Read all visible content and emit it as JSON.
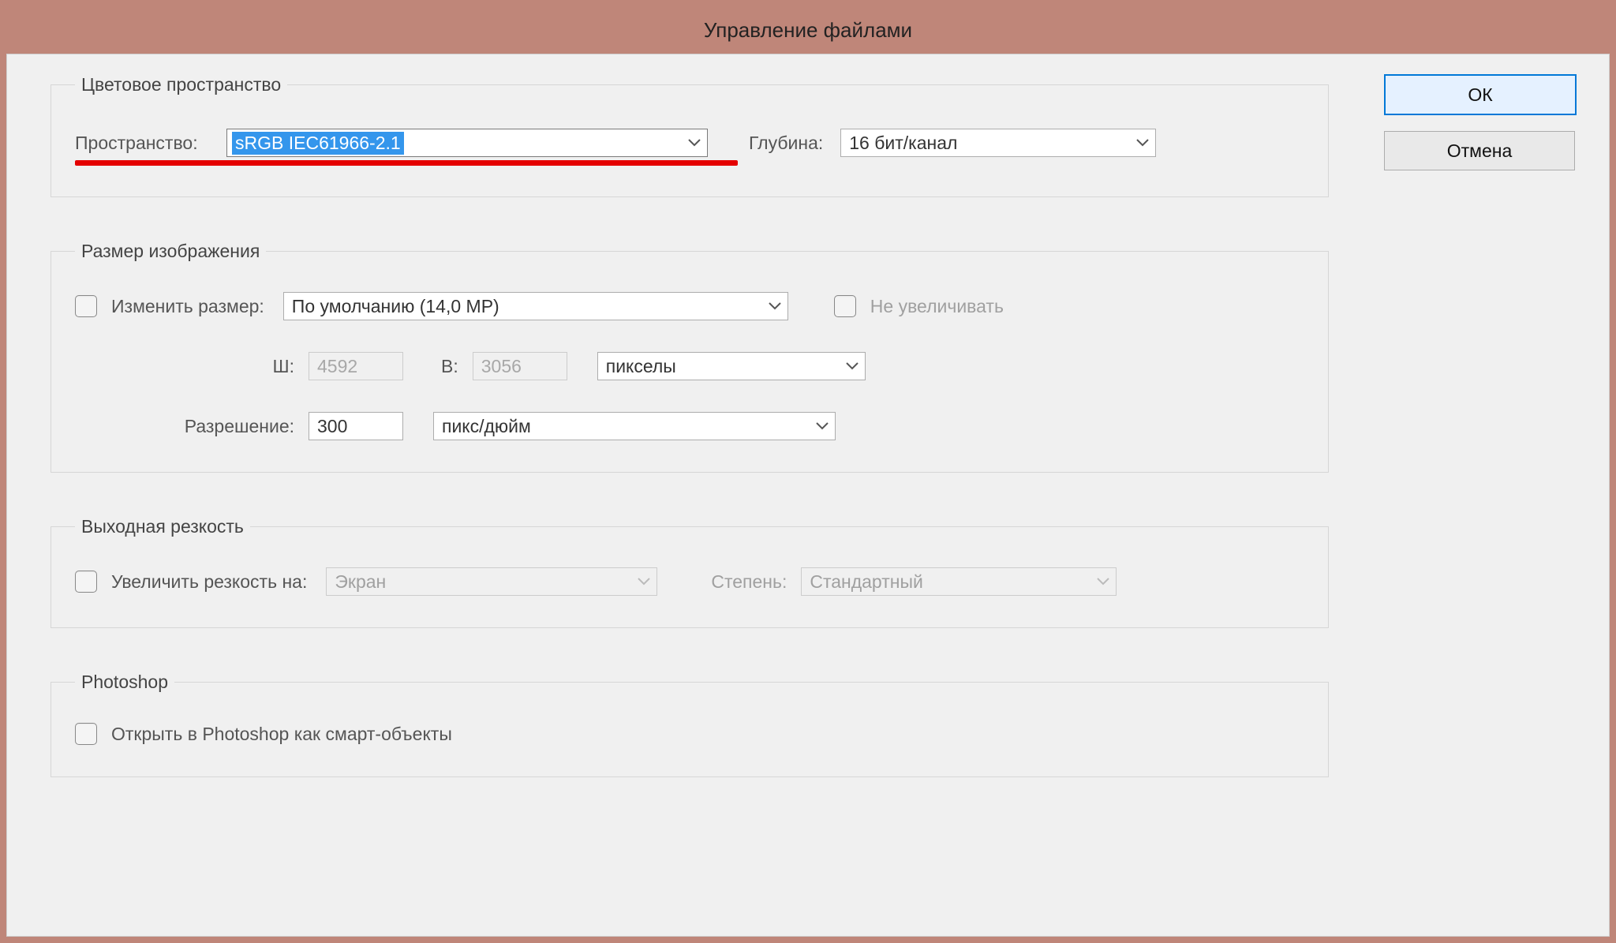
{
  "window_title": "Управление файлами",
  "buttons": {
    "ok": "ОК",
    "cancel": "Отмена"
  },
  "color_space": {
    "legend": "Цветовое пространство",
    "space_label": "Пространство:",
    "space_value": "sRGB IEC61966-2.1",
    "depth_label": "Глубина:",
    "depth_value": "16 бит/канал"
  },
  "image_size": {
    "legend": "Размер изображения",
    "resize_label": "Изменить размер:",
    "preset_value": "По умолчанию (14,0 MP)",
    "no_upscale_label": "Не увеличивать",
    "w_label": "Ш:",
    "w_value": "4592",
    "h_label": "В:",
    "h_value": "3056",
    "unit_value": "пикселы",
    "res_label": "Разрешение:",
    "res_value": "300",
    "res_unit_value": "пикс/дюйм"
  },
  "output_sharp": {
    "legend": "Выходная резкость",
    "sharpen_label": "Увеличить резкость на:",
    "target_value": "Экран",
    "amount_label": "Степень:",
    "amount_value": "Стандартный"
  },
  "photoshop": {
    "legend": "Photoshop",
    "open_smart_label": "Открыть в Photoshop как смарт-объекты"
  }
}
